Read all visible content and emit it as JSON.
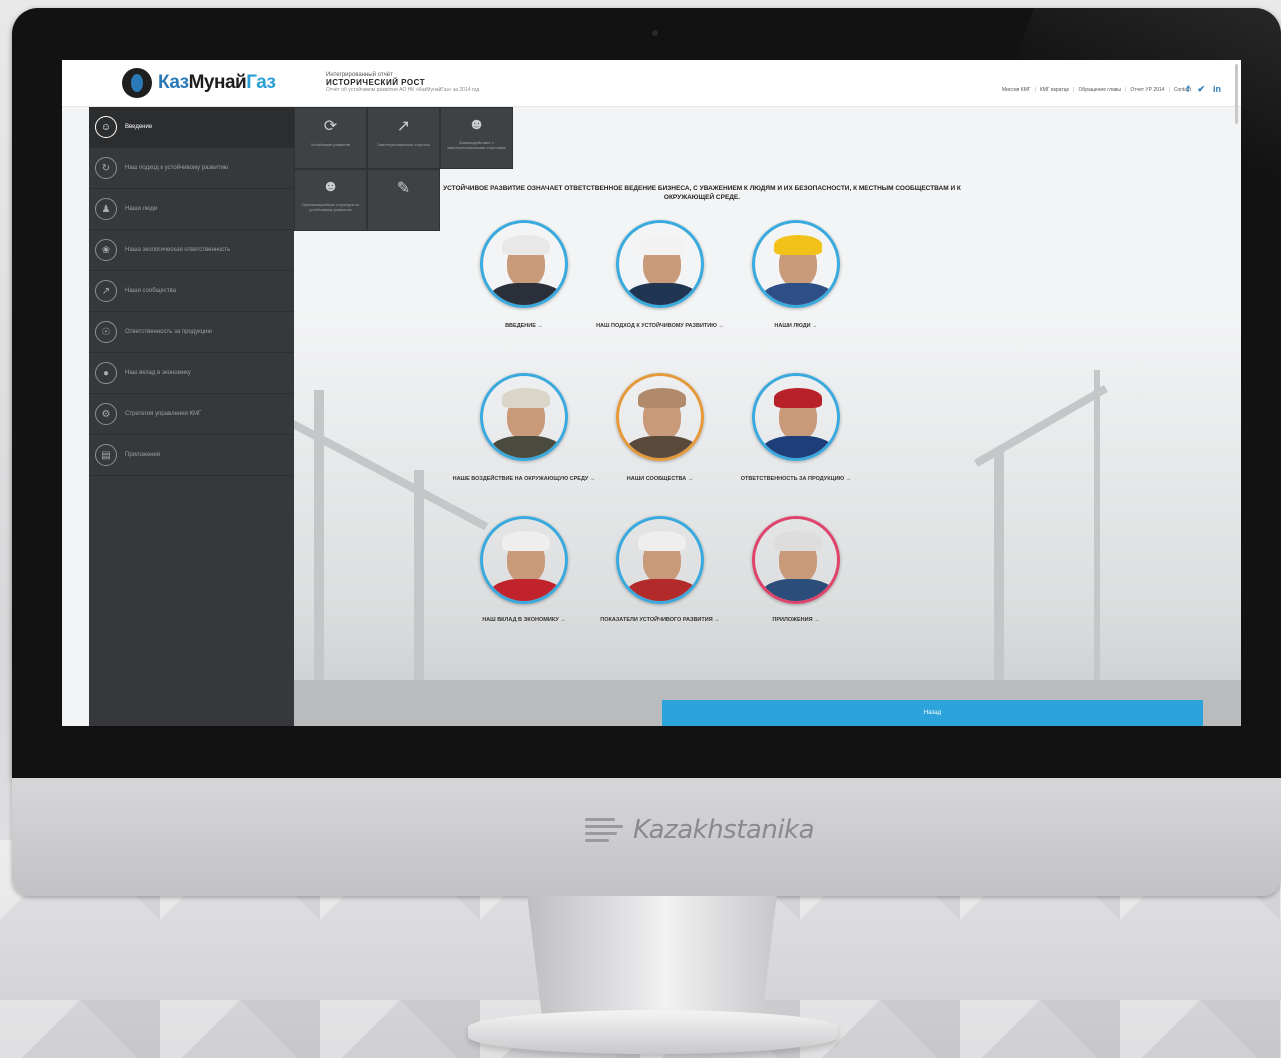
{
  "brand": {
    "name": "Kazakhstanika"
  },
  "header": {
    "logo": {
      "part1": "Каз",
      "part2": "Мунай",
      "part3": "Газ"
    },
    "title_small": "Интегрированный отчёт",
    "title_main": "ИСТОРИЧЕСКИЙ РОСТ",
    "title_sub": "Отчёт об устойчивом развитии АО НК «КазМунайГаз» за 2014 год",
    "nav": [
      "Миссия КМГ",
      "КМГ вкратце",
      "Обращение главы",
      "Отчет УР 2014",
      "Contact"
    ],
    "social": [
      "f",
      "✔",
      "in"
    ]
  },
  "sidebar": {
    "items": [
      {
        "label": "Введение",
        "icon": "user-icon",
        "active": true
      },
      {
        "label": "Наш подход к устойчивому развитию",
        "icon": "refresh-icon",
        "active": false
      },
      {
        "label": "Наши люди",
        "icon": "people-icon",
        "active": false
      },
      {
        "label": "Наша экологическая ответственность",
        "icon": "leaf-icon",
        "active": false
      },
      {
        "label": "Наши сообщества",
        "icon": "chart-icon",
        "active": false
      },
      {
        "label": "Ответственность за продукцию",
        "icon": "globe-icon",
        "active": false
      },
      {
        "label": "Наш вклад в экономику",
        "icon": "coin-icon",
        "active": false
      },
      {
        "label": "Стратегия управления КМГ",
        "icon": "gear-icon",
        "active": false
      },
      {
        "label": "Приложения",
        "icon": "document-icon",
        "active": false
      }
    ]
  },
  "submenu": {
    "tiles": [
      {
        "label": "Устойчивое развитие",
        "icon": "cycle-icon"
      },
      {
        "label": "Заинтересованные стороны",
        "icon": "chart-icon"
      },
      {
        "label": "Взаимодействие с заинтересованными сторонами",
        "icon": "user-icon"
      },
      {
        "label": "Организационная структура по устойчивому развитию",
        "icon": "user-icon"
      },
      {
        "label": "",
        "icon": "pencil-icon"
      }
    ]
  },
  "headline": "УСТОЙЧИВОЕ РАЗВИТИЕ ОЗНАЧАЕТ ОТВЕТСТВЕННОЕ ВЕДЕНИЕ БИЗНЕСА, С УВАЖЕНИЕМ К ЛЮДЯМ И ИХ БЕЗОПАСНОСТИ, К МЕСТНЫМ СООБЩЕСТВАМ И К ОКРУЖАЮЩЕЙ СРЕДЕ.",
  "people": [
    {
      "label": "ВВЕДЕНИЕ →",
      "ring": "#3aa9dd",
      "hat": "#e8e8e8",
      "body": "#2b2f3a"
    },
    {
      "label": "НАШ ПОДХОД К УСТОЙЧИВОМУ РАЗВИТИЮ →",
      "ring": "#3aa9dd",
      "hat": "#f2f2f2",
      "body": "#1f3552"
    },
    {
      "label": "НАШИ ЛЮДИ →",
      "ring": "#3aa9dd",
      "hat": "#f2c21b",
      "body": "#2d4f86"
    },
    {
      "label": "НАШЕ ВОЗДЕЙСТВИЕ НА ОКРУЖАЮЩУЮ СРЕДУ →",
      "ring": "#3aa9dd",
      "hat": "#d9d6c8",
      "body": "#4a4a3e"
    },
    {
      "label": "НАШИ СООБЩЕСТВА →",
      "ring": "#e49a3a",
      "hat": "#b08a6a",
      "body": "#5a4a3c"
    },
    {
      "label": "ОТВЕТСТВЕННОСТЬ ЗА ПРОДУКЦИЮ →",
      "ring": "#3aa9dd",
      "hat": "#b8202a",
      "body": "#1d3e79"
    },
    {
      "label": "НАШ ВКЛАД В ЭКОНОМИКУ →",
      "ring": "#3aa9dd",
      "hat": "#eeeeee",
      "body": "#c0232c"
    },
    {
      "label": "ПОКАЗАТЕЛИ УСТОЙЧИВОГО РАЗВИТИЯ →",
      "ring": "#3aa9dd",
      "hat": "#eeeeee",
      "body": "#b22a2a"
    },
    {
      "label": "ПРИЛОЖЕНИЯ →",
      "ring": "#e0436a",
      "hat": "#dddddd",
      "body": "#2b4d7a"
    }
  ],
  "bottom_bar": {
    "label": "Назад"
  },
  "colors": {
    "accent": "#2da3dc",
    "sidebar": "#36383b"
  }
}
